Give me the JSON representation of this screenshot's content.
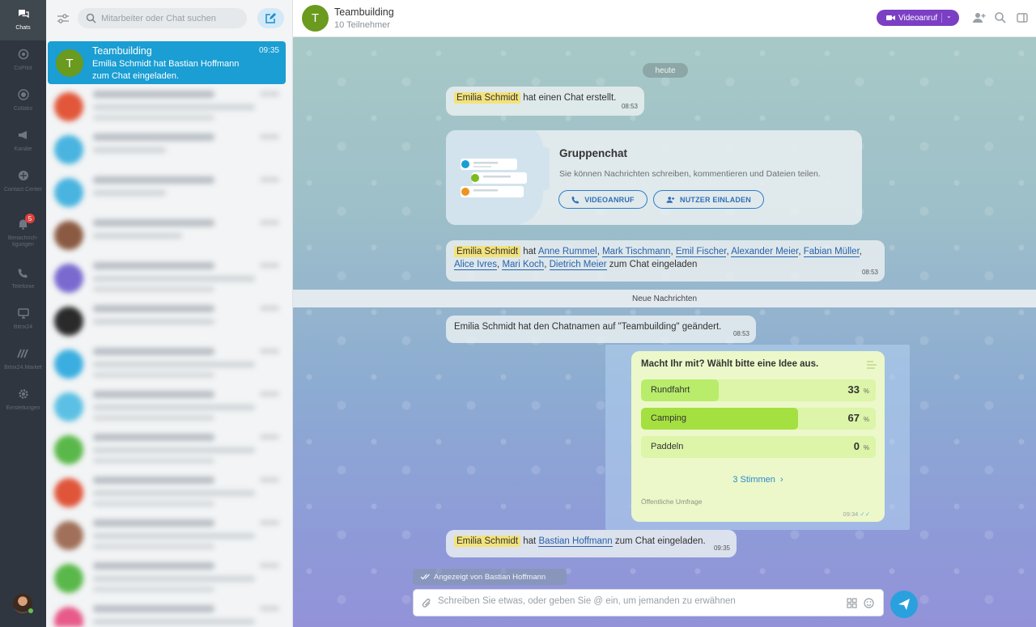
{
  "rail": {
    "items": [
      {
        "label": "Chats",
        "icon": "chat-icon",
        "active": true
      },
      {
        "label": "CoPilot",
        "icon": "copilot-icon"
      },
      {
        "label": "Collabs",
        "icon": "collabs-icon"
      },
      {
        "label": "Kanäle",
        "icon": "megaphone-icon"
      },
      {
        "label": "Contact Center",
        "icon": "contact-center-icon"
      },
      {
        "label": "Benachrich-\ntigungen",
        "icon": "bell-icon",
        "badge": "5"
      },
      {
        "label": "Telefonie",
        "icon": "phone-icon"
      },
      {
        "label": "Bitrix24",
        "icon": "monitor-icon"
      },
      {
        "label": "Bitrix24.Market",
        "icon": "market-icon"
      },
      {
        "label": "Einstellungen",
        "icon": "gear-icon"
      }
    ]
  },
  "list": {
    "search_placeholder": "Mitarbeiter oder Chat suchen",
    "active_chat": {
      "avatar_letter": "T",
      "name": "Teambuilding",
      "time": "09:35",
      "message": "Emilia Schmidt hat Bastian Hoffmann zum Chat eingeladen."
    }
  },
  "header": {
    "avatar_letter": "T",
    "title": "Teambuilding",
    "subtitle": "10 Teilnehmer",
    "video_label": "Videoanruf"
  },
  "messages": {
    "day": "heute",
    "created": {
      "user": "Emilia Schmidt",
      "text": "hat einen Chat erstellt.",
      "time": "08:53"
    },
    "group_card": {
      "title": "Gruppenchat",
      "description": "Sie können Nachrichten schreiben, kommentieren und Dateien teilen.",
      "video_btn": "VIDEOANRUF",
      "invite_btn": "NUTZER EINLADEN"
    },
    "invited": {
      "user": "Emilia Schmidt",
      "verb": "hat",
      "names": [
        "Anne Rummel",
        "Mark Tischmann",
        "Emil Fischer",
        "Alexander Meier",
        "Fabian Müller",
        "Alice Ivres",
        "Mari Koch",
        "Dietrich Meier"
      ],
      "suffix": "zum Chat eingeladen",
      "time": "08:53"
    },
    "new_messages": "Neue Nachrichten",
    "renamed": {
      "text": "Emilia Schmidt hat den Chatnamen auf \"Teambuilding\" geändert.",
      "time": "08:53"
    },
    "poll": {
      "question": "Macht Ihr mit? Wählt bitte eine Idee aus.",
      "options": [
        {
          "label": "Rundfahrt",
          "percent": 33
        },
        {
          "label": "Camping",
          "percent": 67
        },
        {
          "label": "Paddeln",
          "percent": 0
        }
      ],
      "percent_sign": "%",
      "votes": "3 Stimmen",
      "type": "Öffentliche Umfrage",
      "time": "09:34"
    },
    "invited2": {
      "user": "Emilia Schmidt",
      "verb": "hat",
      "target": "Bastian Hoffmann",
      "suffix": "zum Chat eingeladen.",
      "time": "09:35"
    },
    "seen": "Angezeigt von Bastian Hoffmann"
  },
  "composer": {
    "placeholder": "Schreiben Sie etwas, oder geben Sie @ ein, um jemanden zu erwähnen"
  },
  "colors": {
    "accent": "#1a9ed3",
    "video": "#7b3fc4",
    "poll_bg": "#ecf8c9",
    "poll_fill_low": "#b8ec6a",
    "poll_fill_high": "#a4e040"
  }
}
